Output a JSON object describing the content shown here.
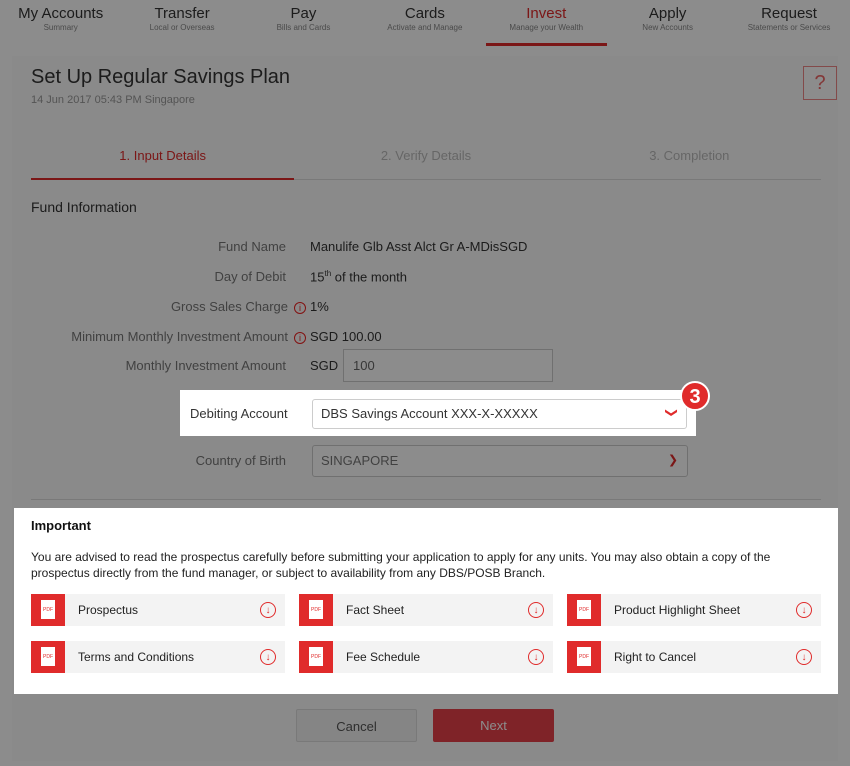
{
  "nav": [
    {
      "label": "My Accounts",
      "sub": "Summary"
    },
    {
      "label": "Transfer",
      "sub": "Local or Overseas"
    },
    {
      "label": "Pay",
      "sub": "Bills and Cards"
    },
    {
      "label": "Cards",
      "sub": "Activate and Manage"
    },
    {
      "label": "Invest",
      "sub": "Manage your Wealth"
    },
    {
      "label": "Apply",
      "sub": "New Accounts"
    },
    {
      "label": "Request",
      "sub": "Statements or Services"
    }
  ],
  "page": {
    "title": "Set Up Regular Savings Plan",
    "timestamp": "14 Jun 2017 05:43 PM Singapore",
    "help": "?"
  },
  "steps": [
    "1. Input Details",
    "2. Verify Details",
    "3. Completion"
  ],
  "fund": {
    "section_title": "Fund Information",
    "fund_name_label": "Fund Name",
    "fund_name": "Manulife Glb Asst Alct Gr A-MDisSGD",
    "debit_day_label": "Day of Debit",
    "debit_day_num": "15",
    "debit_day_sup": "th",
    "debit_day_rest": " of the month",
    "sales_charge_label": "Gross Sales Charge",
    "sales_charge": "1%",
    "min_amount_label": "Minimum Monthly Investment Amount",
    "min_amount": "SGD 100.00",
    "monthly_label": "Monthly Investment Amount",
    "currency": "SGD",
    "monthly_value": "100",
    "debit_account_label": "Debiting Account",
    "debit_account": "DBS Savings Account XXX-X-XXXXX",
    "birth_label": "Country of Birth",
    "birth_value": "SINGAPORE"
  },
  "badge": "3",
  "important": {
    "title": "Important",
    "text": "You are advised to read the prospectus carefully before submitting your application to apply for any units. You may also obtain a copy of the prospectus directly from the fund manager, or subject to availability from any DBS/POSB Branch.",
    "pdf_tag": "PDF",
    "docs": [
      "Prospectus",
      "Fact Sheet",
      "Product Highlight Sheet",
      "Terms and Conditions",
      "Fee Schedule",
      "Right to Cancel"
    ]
  },
  "buttons": {
    "cancel": "Cancel",
    "next": "Next"
  },
  "colors": {
    "accent": "#e02b2b"
  }
}
